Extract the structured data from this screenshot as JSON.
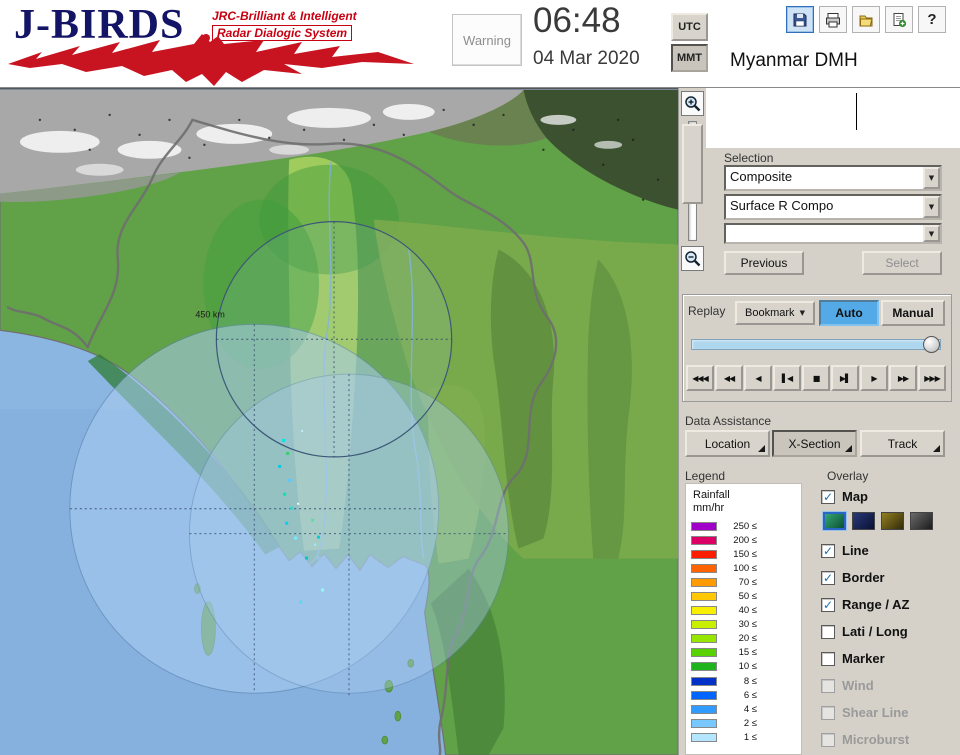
{
  "header": {
    "logo": {
      "title": "J-BIRDS",
      "subtitle_line1": "JRC-Brilliant & Intelligent",
      "subtitle_line2": "Radar  Dialogic  System"
    },
    "warning_label": "Warning",
    "clock": {
      "time": "06:48",
      "date": "04 Mar 2020"
    },
    "timezone": {
      "utc": "UTC",
      "mmt": "MMT",
      "active": "MMT"
    },
    "toolbar_icons": [
      "save-icon",
      "print-icon",
      "open-folder-icon",
      "export-icon",
      "help-icon"
    ],
    "station": "Myanmar DMH"
  },
  "map": {
    "range_ring_label": "450 km"
  },
  "panel": {
    "selection": {
      "label": "Selection",
      "dropdown_composite": "Composite",
      "dropdown_product": "Surface R Compo",
      "dropdown_extra": "",
      "previous_button": "Previous",
      "select_button": "Select"
    },
    "replay": {
      "label": "Replay",
      "bookmark_button": "Bookmark",
      "auto_button": "Auto",
      "manual_button": "Manual",
      "mode_active": "Auto",
      "playback": [
        {
          "name": "jump-start-button",
          "glyph": "◀◀◀"
        },
        {
          "name": "fast-rewind-button",
          "glyph": "◀◀"
        },
        {
          "name": "play-reverse-button",
          "glyph": "◀"
        },
        {
          "name": "step-back-button",
          "glyph": "▌◀"
        },
        {
          "name": "stop-button",
          "glyph": "■"
        },
        {
          "name": "step-forward-button",
          "glyph": "▶▌"
        },
        {
          "name": "play-button",
          "glyph": "▶"
        },
        {
          "name": "fast-forward-button",
          "glyph": "▶▶"
        },
        {
          "name": "jump-end-button",
          "glyph": "▶▶▶"
        }
      ]
    },
    "data_assistance": {
      "label": "Data Assistance",
      "location_button": "Location",
      "xsection_button": "X-Section",
      "track_button": "Track"
    },
    "legend": {
      "label": "Legend",
      "unit_line1": "Rainfall",
      "unit_line2": "mm/hr",
      "entries": [
        {
          "label": "250 ≤",
          "color": "#a000c8"
        },
        {
          "label": "200 ≤",
          "color": "#dc0064"
        },
        {
          "label": "150 ≤",
          "color": "#ff1e00"
        },
        {
          "label": "100 ≤",
          "color": "#ff6400"
        },
        {
          "label": "70 ≤",
          "color": "#ff9b00"
        },
        {
          "label": "50 ≤",
          "color": "#ffc800"
        },
        {
          "label": "40 ≤",
          "color": "#f8f000"
        },
        {
          "label": "30 ≤",
          "color": "#c8f000"
        },
        {
          "label": "20 ≤",
          "color": "#96e600"
        },
        {
          "label": "15 ≤",
          "color": "#5ad200"
        },
        {
          "label": "10 ≤",
          "color": "#1eb41e"
        },
        {
          "label": "8 ≤",
          "color": "#0032c8"
        },
        {
          "label": "6 ≤",
          "color": "#0064ff"
        },
        {
          "label": "4 ≤",
          "color": "#329bff"
        },
        {
          "label": "2 ≤",
          "color": "#78c8ff"
        },
        {
          "label": "1 ≤",
          "color": "#b4e6ff"
        }
      ]
    },
    "overlay": {
      "label": "Overlay",
      "map_item": {
        "label": "Map",
        "checked": true
      },
      "style_swatches": [
        {
          "selected": true,
          "c1": "#35a774",
          "c2": "#0b4f33"
        },
        {
          "selected": false,
          "c1": "#2a3a78",
          "c2": "#0a1034"
        },
        {
          "selected": false,
          "c1": "#938020",
          "c2": "#322b0a"
        },
        {
          "selected": false,
          "c1": "#6a6a6a",
          "c2": "#1c1c1c"
        }
      ],
      "items": [
        {
          "label": "Line",
          "checked": true,
          "enabled": true
        },
        {
          "label": "Border",
          "checked": true,
          "enabled": true
        },
        {
          "label": "Range / AZ",
          "checked": true,
          "enabled": true
        },
        {
          "label": "Lati / Long",
          "checked": false,
          "enabled": true
        },
        {
          "label": "Marker",
          "checked": false,
          "enabled": true
        },
        {
          "label": "Wind",
          "checked": false,
          "enabled": false
        },
        {
          "label": "Shear Line",
          "checked": false,
          "enabled": false
        },
        {
          "label": "Microburst",
          "checked": false,
          "enabled": false
        }
      ]
    }
  }
}
